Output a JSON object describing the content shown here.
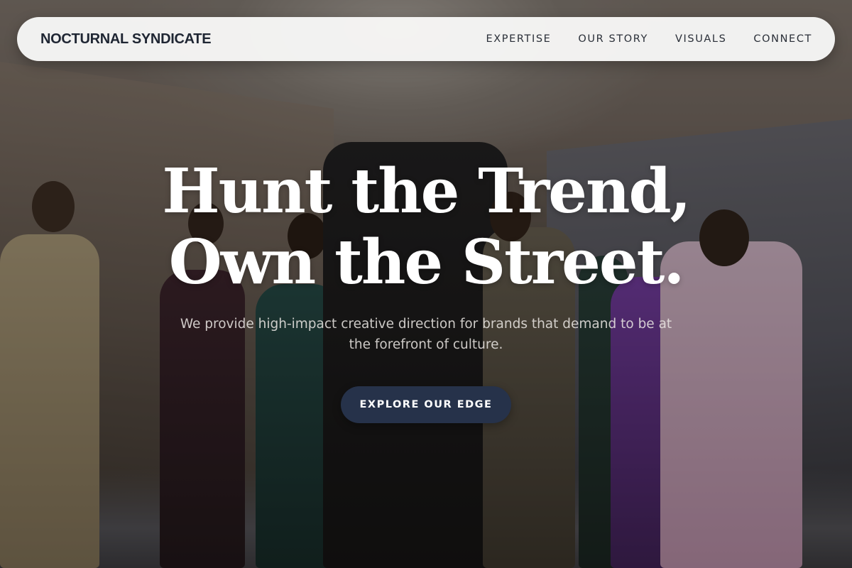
{
  "nav": {
    "brand": "NOCTURNAL SYNDICATE",
    "links": [
      {
        "label": "EXPERTISE"
      },
      {
        "label": "OUR STORY"
      },
      {
        "label": "VISUALS"
      },
      {
        "label": "CONNECT"
      }
    ]
  },
  "hero": {
    "headline_line1": "Hunt the Trend,",
    "headline_line2": "Own the Street.",
    "subtitle": "We provide high-impact creative direction for brands that demand to be at the forefront of culture.",
    "cta_label": "EXPLORE OUR EDGE",
    "background_image": "fashion-group-photo"
  },
  "colors": {
    "nav_bg": "#f8f8f7",
    "brand_text": "#1f2633",
    "cta_bg": "#26324a",
    "headline": "#ffffff"
  }
}
